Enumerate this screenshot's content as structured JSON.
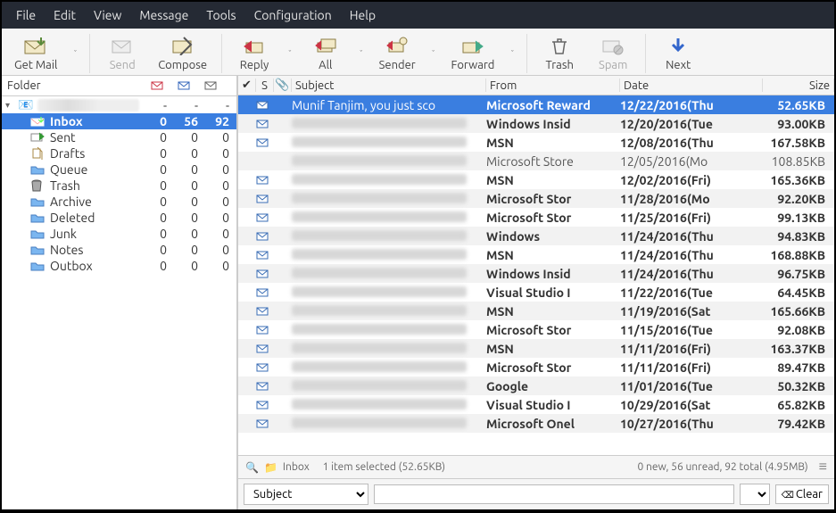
{
  "menu": [
    "File",
    "Edit",
    "View",
    "Message",
    "Tools",
    "Configuration",
    "Help"
  ],
  "toolbar": {
    "getmail": "Get Mail",
    "send": "Send",
    "compose": "Compose",
    "reply": "Reply",
    "all": "All",
    "sender": "Sender",
    "forward": "Forward",
    "trash": "Trash",
    "spam": "Spam",
    "next": "Next"
  },
  "folder_header": "Folder",
  "account_name": "(account)",
  "folders": [
    {
      "name": "Inbox",
      "c1": "0",
      "c2": "56",
      "c3": "92",
      "selected": true,
      "icon": "inbox"
    },
    {
      "name": "Sent",
      "c1": "0",
      "c2": "0",
      "c3": "0",
      "icon": "sent"
    },
    {
      "name": "Drafts",
      "c1": "0",
      "c2": "0",
      "c3": "0",
      "icon": "drafts"
    },
    {
      "name": "Queue",
      "c1": "0",
      "c2": "0",
      "c3": "0",
      "icon": "folder"
    },
    {
      "name": "Trash",
      "c1": "0",
      "c2": "0",
      "c3": "0",
      "icon": "trash"
    },
    {
      "name": "Archive",
      "c1": "0",
      "c2": "0",
      "c3": "0",
      "icon": "folder"
    },
    {
      "name": "Deleted",
      "c1": "0",
      "c2": "0",
      "c3": "0",
      "icon": "folder"
    },
    {
      "name": "Junk",
      "c1": "0",
      "c2": "0",
      "c3": "0",
      "icon": "folder"
    },
    {
      "name": "Notes",
      "c1": "0",
      "c2": "0",
      "c3": "0",
      "icon": "folder"
    },
    {
      "name": "Outbox",
      "c1": "0",
      "c2": "0",
      "c3": "0",
      "icon": "folder"
    }
  ],
  "col": {
    "subject": "Subject",
    "from": "From",
    "date": "Date",
    "size": "Size",
    "s": "S"
  },
  "messages": [
    {
      "subject": "Munif Tanjim, you just sco",
      "from": "Microsoft Reward",
      "date": "12/22/2016(Thu",
      "size": "52.65KB",
      "sel": true,
      "unread": true,
      "alt": false
    },
    {
      "subject": "",
      "from": "Windows Insid",
      "date": "12/20/2016(Tue",
      "size": "93.00KB",
      "unread": true,
      "alt": true
    },
    {
      "subject": "",
      "from": "MSN",
      "date": "12/08/2016(Thu",
      "size": "167.58KB",
      "unread": true,
      "alt": false
    },
    {
      "subject": "",
      "from": "Microsoft Store",
      "date": "12/05/2016(Mo",
      "size": "108.85KB",
      "unread": false,
      "alt": true
    },
    {
      "subject": "",
      "from": "MSN",
      "date": "12/02/2016(Fri)",
      "size": "165.36KB",
      "unread": true,
      "alt": false
    },
    {
      "subject": "",
      "from": "Microsoft Stor",
      "date": "11/28/2016(Mo",
      "size": "92.20KB",
      "unread": true,
      "alt": true
    },
    {
      "subject": "",
      "from": "Microsoft Stor",
      "date": "11/25/2016(Fri)",
      "size": "99.13KB",
      "unread": true,
      "alt": false
    },
    {
      "subject": "",
      "from": "Windows",
      "date": "11/24/2016(Thu",
      "size": "94.83KB",
      "unread": true,
      "alt": true
    },
    {
      "subject": "",
      "from": "MSN",
      "date": "11/24/2016(Thu",
      "size": "168.88KB",
      "unread": true,
      "alt": false
    },
    {
      "subject": "",
      "from": "Windows Insid",
      "date": "11/24/2016(Thu",
      "size": "96.75KB",
      "unread": true,
      "alt": true
    },
    {
      "subject": "",
      "from": "Visual Studio I",
      "date": "11/22/2016(Tue",
      "size": "64.45KB",
      "unread": true,
      "alt": false
    },
    {
      "subject": "",
      "from": "MSN",
      "date": "11/19/2016(Sat",
      "size": "165.66KB",
      "unread": true,
      "alt": true
    },
    {
      "subject": "",
      "from": "Microsoft Stor",
      "date": "11/15/2016(Tue",
      "size": "92.08KB",
      "unread": true,
      "alt": false
    },
    {
      "subject": "",
      "from": "MSN",
      "date": "11/11/2016(Fri)",
      "size": "163.37KB",
      "unread": true,
      "alt": true
    },
    {
      "subject": "",
      "from": "Microsoft Stor",
      "date": "11/11/2016(Fri)",
      "size": "89.47KB",
      "unread": true,
      "alt": false
    },
    {
      "subject": "",
      "from": "Google",
      "date": "11/01/2016(Tue",
      "size": "50.32KB",
      "unread": true,
      "alt": true
    },
    {
      "subject": "",
      "from": "Visual Studio I",
      "date": "10/29/2016(Sat",
      "size": "65.82KB",
      "unread": true,
      "alt": false
    },
    {
      "subject": "",
      "from": "Microsoft Onel",
      "date": "10/27/2016(Thu",
      "size": "79.42KB",
      "unread": true,
      "alt": true
    }
  ],
  "status": {
    "folder": "Inbox",
    "selected": "1 item selected (52.65KB)",
    "summary": "0 new, 56 unread, 92 total (4.95MB)"
  },
  "search": {
    "field": "Subject",
    "clear": "Clear"
  }
}
